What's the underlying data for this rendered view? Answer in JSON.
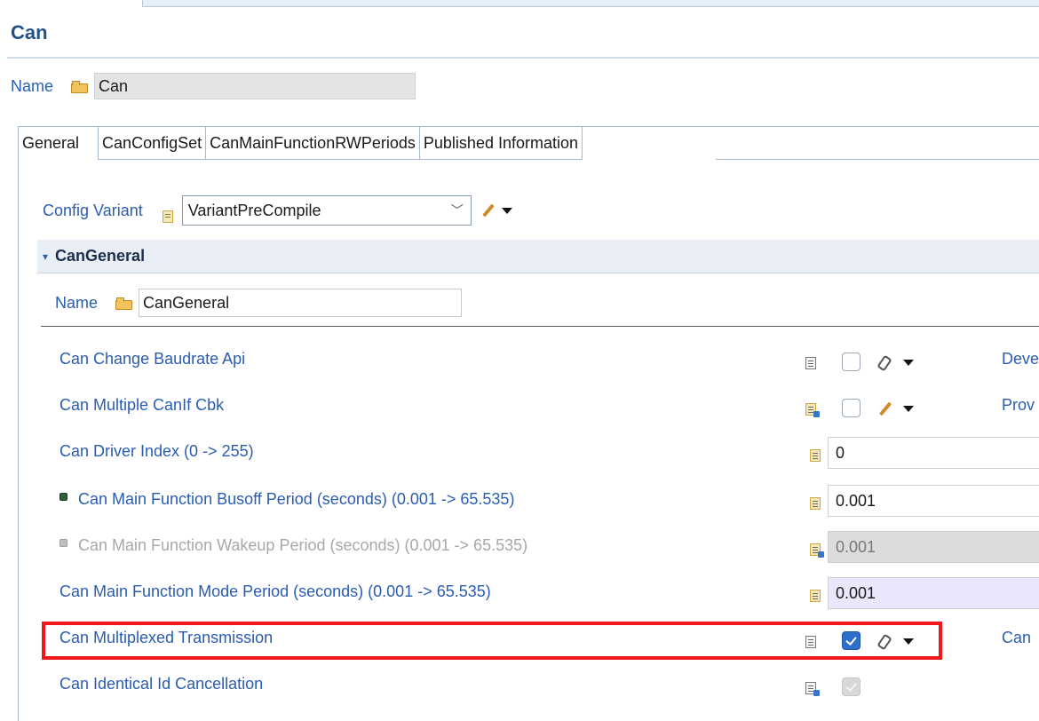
{
  "editor": {
    "title": "Can",
    "name_label": "Name",
    "name_value": "Can"
  },
  "tabs": [
    {
      "label": "General",
      "active": true
    },
    {
      "label": "CanConfigSet",
      "active": false
    },
    {
      "label": "CanMainFunctionRWPeriods",
      "active": false
    },
    {
      "label": "Published Information",
      "active": false
    }
  ],
  "config_variant": {
    "label": "Config Variant",
    "value": "VariantPreCompile"
  },
  "section": {
    "title": "CanGeneral",
    "name_label": "Name",
    "name_value": "CanGeneral"
  },
  "params": [
    {
      "label": "Can Change Baudrate Api",
      "kind": "checkbox",
      "checked": false,
      "tool": "wrench",
      "right_text": "Deve"
    },
    {
      "label": "Can Multiple CanIf Cbk",
      "kind": "checkbox",
      "checked": false,
      "tool": "pencil",
      "right_text": "Prov"
    },
    {
      "label": "Can Driver Index (0 -> 255)",
      "kind": "value",
      "value": "0"
    },
    {
      "label": "Can Main Function Busoff Period (seconds) (0.001 -> 65.535)",
      "kind": "value",
      "value": "0.001",
      "status": "active"
    },
    {
      "label": "Can Main Function Wakeup Period (seconds) (0.001 -> 65.535)",
      "kind": "value",
      "value": "0.001",
      "status": "inactive"
    },
    {
      "label": "Can Main Function Mode Period (seconds) (0.001 -> 65.535)",
      "kind": "value",
      "value": "0.001"
    },
    {
      "label": "Can Multiplexed Transmission",
      "kind": "checkbox",
      "checked": true,
      "tool": "wrench",
      "right_text": "Can"
    },
    {
      "label": "Can Identical Id Cancellation",
      "kind": "checkbox",
      "checked": true,
      "disabled": true
    }
  ]
}
